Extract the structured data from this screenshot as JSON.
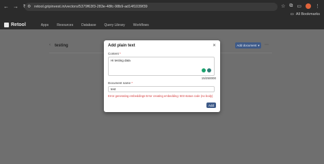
{
  "browser": {
    "url": "retool.gripinvest.in/vectors/5379f63f3-283e-48fc-98b9-ad14f1039f39",
    "bookmarks_label": "All Bookmarks"
  },
  "appbar": {
    "brand": "Retool",
    "nav": [
      "Apps",
      "Resources",
      "Database",
      "Query Library",
      "Workflows"
    ]
  },
  "page": {
    "title": "testing",
    "add_document_label": "Add document"
  },
  "modal": {
    "title": "Add plain text",
    "content_label": "Content",
    "content_value": "Hi testing data",
    "char_count": "15/250000",
    "doc_name_label": "Document name",
    "doc_name_value": "test",
    "error": "Error generating embeddings Error creating embedding: 503 status code (no body)",
    "add_label": "Add"
  }
}
